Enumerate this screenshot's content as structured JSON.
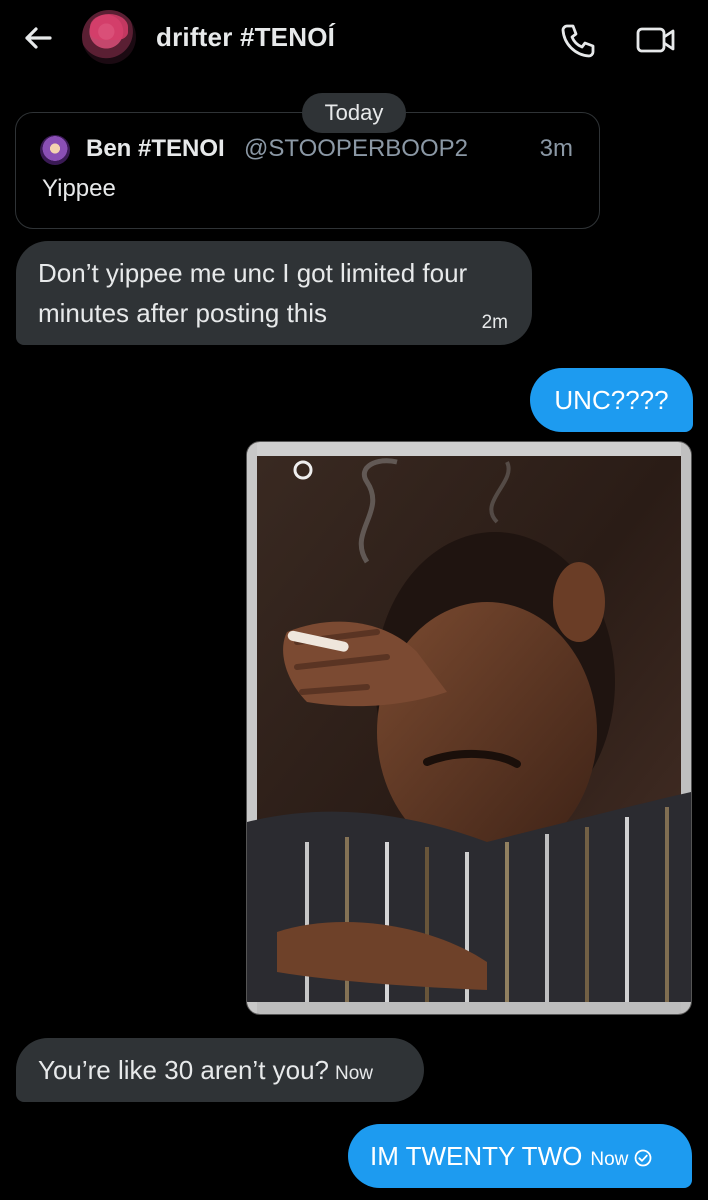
{
  "header": {
    "title": "drifter #TENOÍ",
    "back_icon": "back-arrow-icon",
    "call_icon": "phone-icon",
    "video_icon": "video-icon"
  },
  "date_divider": "Today",
  "quoted_post": {
    "name": "Ben #TENOI",
    "handle": "@STOOPERBOOP2",
    "time": "3m",
    "text": "Yippee"
  },
  "messages": [
    {
      "direction": "incoming",
      "text": "Don’t yippee me unc I got limited four minutes after posting this",
      "time": "2m"
    },
    {
      "direction": "outgoing",
      "text": "UNC????",
      "time": ""
    },
    {
      "direction": "outgoing",
      "type": "image"
    },
    {
      "direction": "incoming",
      "text": "You’re like 30 aren’t you?",
      "time": "Now"
    },
    {
      "direction": "outgoing",
      "text": "IM TWENTY TWO",
      "time": "Now",
      "status_icon": "check-circle-icon"
    }
  ],
  "colors": {
    "background": "#000000",
    "incoming_bubble": "#2f3336",
    "outgoing_bubble": "#1d9bf0",
    "secondary_text": "#8b98a5"
  }
}
